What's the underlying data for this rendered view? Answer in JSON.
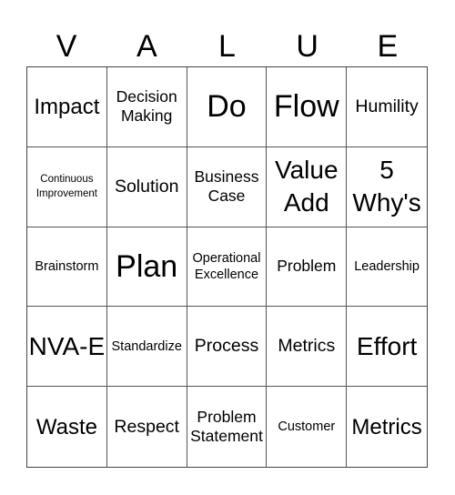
{
  "card": {
    "header_letters": [
      "V",
      "A",
      "L",
      "U",
      "E"
    ],
    "cells": [
      {
        "text": "Impact",
        "size": "lg"
      },
      {
        "text": "Decision Making",
        "size": "md"
      },
      {
        "text": "Do",
        "size": "xxl"
      },
      {
        "text": "Flow",
        "size": "xxl"
      },
      {
        "text": "Humility",
        "size": "mdl"
      },
      {
        "text": "Continuous Improvement",
        "size": "xs"
      },
      {
        "text": "Solution",
        "size": "mdl"
      },
      {
        "text": "Business Case",
        "size": "md"
      },
      {
        "text": "Value Add",
        "size": "xl"
      },
      {
        "text": "5 Why's",
        "size": "xl"
      },
      {
        "text": "Brainstorm",
        "size": "sm"
      },
      {
        "text": "Plan",
        "size": "xxl"
      },
      {
        "text": "Operational Excellence",
        "size": "sm"
      },
      {
        "text": "Problem",
        "size": "md"
      },
      {
        "text": "Leadership",
        "size": "sm"
      },
      {
        "text": "NVA-E",
        "size": "xl"
      },
      {
        "text": "Standardize",
        "size": "sm"
      },
      {
        "text": "Process",
        "size": "mdl"
      },
      {
        "text": "Metrics",
        "size": "mdl"
      },
      {
        "text": "Effort",
        "size": "xl"
      },
      {
        "text": "Waste",
        "size": "lg"
      },
      {
        "text": "Respect",
        "size": "mdl"
      },
      {
        "text": "Problem Statement",
        "size": "md"
      },
      {
        "text": "Customer",
        "size": "sm"
      },
      {
        "text": "Metrics",
        "size": "lg"
      }
    ]
  }
}
